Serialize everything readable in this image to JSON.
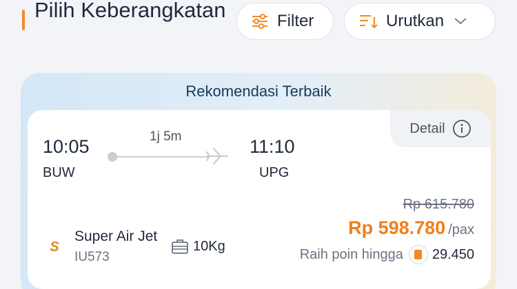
{
  "header": {
    "title": "Pilih Keberangkatan",
    "filter_label": "Filter",
    "sort_label": "Urutkan"
  },
  "recommendation": {
    "title": "Rekomendasi Terbaik"
  },
  "flight": {
    "detail_label": "Detail",
    "depart_time": "10:05",
    "depart_code": "BUW",
    "arrive_time": "11:10",
    "arrive_code": "UPG",
    "duration": "1j 5m",
    "airline_name": "Super Air Jet",
    "flight_number": "IU573",
    "baggage": "10Kg",
    "old_price": "Rp 615.780",
    "price": "Rp 598.780",
    "price_unit": "/pax",
    "points_label": "Raih poin hingga",
    "points_value": "29.450"
  },
  "colors": {
    "accent": "#f08a24",
    "price": "#f07e1a",
    "title": "#163a5a"
  },
  "icons": {
    "filter": "sliders-icon",
    "sort": "sort-icon",
    "dropdown": "chevron-down-icon",
    "detail": "info-icon",
    "plane": "plane-icon",
    "baggage": "suitcase-icon",
    "points": "coin-icon"
  }
}
